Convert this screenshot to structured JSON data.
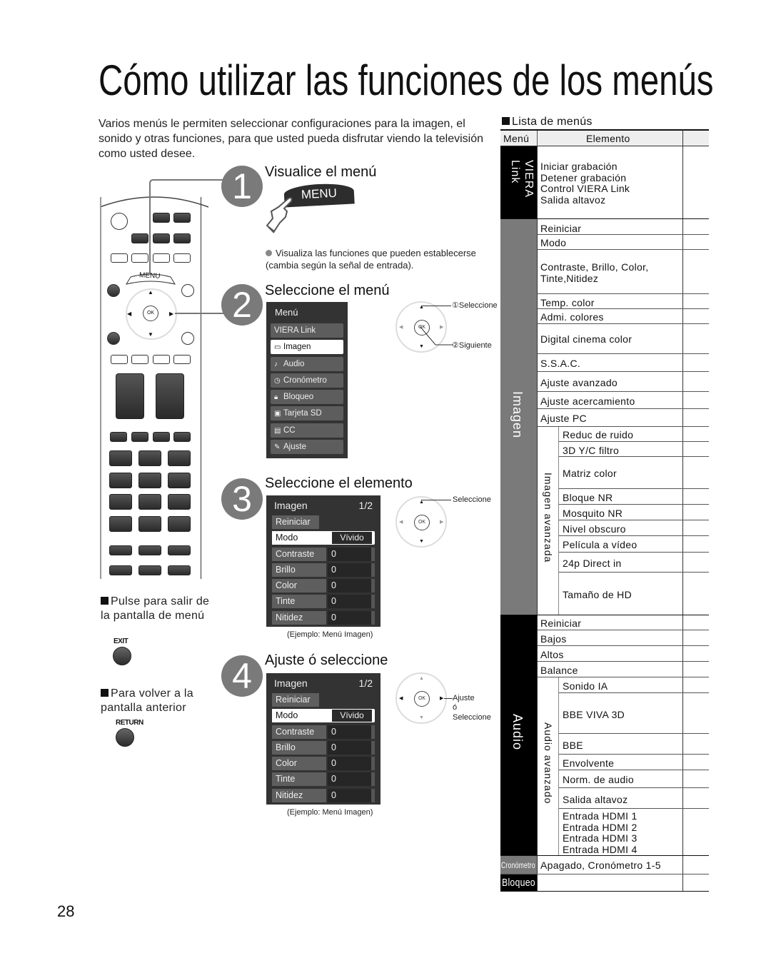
{
  "title": "Cómo utilizar las funciones de los menús",
  "intro": "Varios menús le permiten seleccionar configuraciones para la imagen, el sonido y otras funciones, para que usted pueda disfrutar viendo la televisión como usted desee.",
  "remote": {
    "menu_label": "MENU",
    "ok_label": "OK"
  },
  "steps": [
    {
      "number": "1",
      "title": "Visualice el menú",
      "button": "MENU",
      "note": "Visualiza las funciones que pueden establecerse (cambia según la señal de entrada)."
    },
    {
      "number": "2",
      "title": "Seleccione el menú",
      "menu": {
        "header": "Menú",
        "items": [
          {
            "label": "VIERA Link",
            "icon": ""
          },
          {
            "label": "Imagen",
            "icon": "screen-icon",
            "selected": true
          },
          {
            "label": "Audio",
            "icon": "music-note-icon"
          },
          {
            "label": "Cronómetro",
            "icon": "clock-icon"
          },
          {
            "label": "Bloqueo",
            "icon": "lock-icon"
          },
          {
            "label": "Tarjeta SD",
            "icon": "sd-card-icon"
          },
          {
            "label": "CC",
            "icon": "cc-icon"
          },
          {
            "label": "Ajuste",
            "icon": "wrench-icon"
          }
        ]
      },
      "dpad_labels": [
        "①Seleccione",
        "②Siguiente"
      ]
    },
    {
      "number": "3",
      "title": "Seleccione el elemento",
      "dpad_labels": [
        "Seleccione"
      ],
      "caption": "(Ejemplo:  Menú Imagen)"
    },
    {
      "number": "4",
      "title": "Ajuste ó seleccione",
      "dpad_labels": [
        "Ajuste",
        "ó",
        "Seleccione"
      ],
      "caption": "(Ejemplo:  Menú Imagen)"
    }
  ],
  "picture_menu": {
    "header": "Imagen",
    "page": "1/2",
    "reset": "Reiniciar",
    "mode_label": "Modo",
    "mode_value": "Vívido",
    "rows": [
      {
        "label": "Contraste",
        "value": "0"
      },
      {
        "label": "Brillo",
        "value": "0"
      },
      {
        "label": "Color",
        "value": "0"
      },
      {
        "label": "Tinte",
        "value": "0"
      },
      {
        "label": "Nitidez",
        "value": "0"
      }
    ]
  },
  "notes": {
    "exit_text": "Pulse para salir de la pantalla de menú",
    "exit_button": "EXIT",
    "return_text": "Para volver a la pantalla anterior",
    "return_button": "RETURN"
  },
  "menu_list": {
    "title": "Lista de menús",
    "col_menu": "Menú",
    "col_item": "Elemento",
    "groups": [
      {
        "menu": "VIERA Link",
        "items": [
          "Iniciar grabación",
          "Detener grabación",
          "Control VIERA Link",
          "Salida altavoz"
        ]
      },
      {
        "menu": "Imagen",
        "items": [
          "Reiniciar",
          "Modo",
          "Contraste, Brillo, Color, Tinte,Nitidez",
          "Temp. color",
          "Admi. colores",
          "Digital cinema color",
          "S.S.A.C.",
          "Ajuste avanzado",
          "Ajuste acercamiento",
          "Ajuste PC"
        ],
        "sub_group": "Imagen avanzada",
        "sub_items": [
          "Reduc de ruido",
          "3D Y/C filtro",
          "Matriz color",
          "Bloque NR",
          "Mosquito NR",
          "Nivel obscuro",
          "Película a vídeo",
          "24p Direct in",
          "Tamaño de HD"
        ]
      },
      {
        "menu": "Audio",
        "items": [
          "Reiniciar",
          "Bajos",
          "Altos",
          "Balance"
        ],
        "sub_group": "Audio avanzado",
        "sub_items": [
          "Sonido IA",
          "BBE VIVA 3D",
          "BBE",
          "Envolvente",
          "Norm. de audio",
          "Salida altavoz",
          "Entrada HDMI 1",
          "Entrada HDMI 2",
          "Entrada HDMI 3",
          "Entrada HDMI 4"
        ]
      },
      {
        "menu": "Cronómetro",
        "items": [
          "Apagado, Cronómetro 1-5"
        ]
      },
      {
        "menu": "Bloqueo",
        "items": []
      }
    ]
  },
  "page_number": "28",
  "colors": {
    "viera_bg": "#000000",
    "imagen_bg": "#7a7a7a",
    "audio_bg": "#000000",
    "cronometro_bg": "#7a7a7a",
    "bloqueo_bg": "#000000",
    "osd_bg": "#333333",
    "step_circle": "#7a7a7a"
  }
}
